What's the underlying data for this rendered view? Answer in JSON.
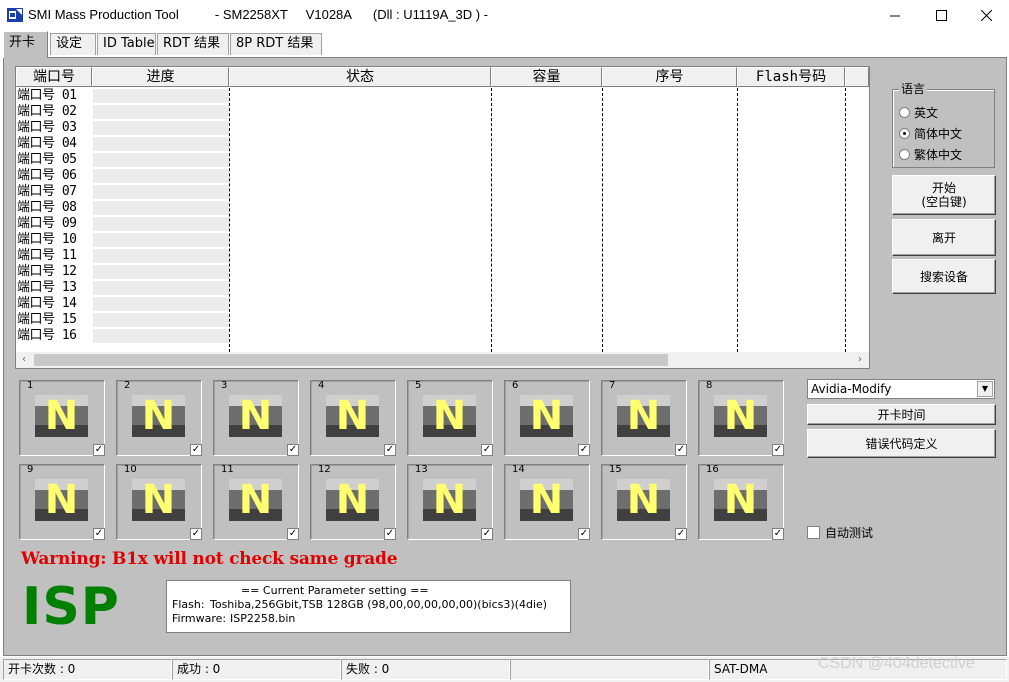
{
  "window": {
    "title": "SMI Mass Production Tool          - SM2258XT     V1028A      (Dll : U1119A_3D ) -",
    "icon": "usb-drive-icon"
  },
  "tabs": [
    {
      "label": "开卡",
      "active": true
    },
    {
      "label": "设定",
      "active": false
    },
    {
      "label": "ID Table",
      "active": false
    },
    {
      "label": "RDT 结果",
      "active": false
    },
    {
      "label": "8P RDT 结果",
      "active": false
    }
  ],
  "grid": {
    "columns": [
      "端口号",
      "进度",
      "状态",
      "容量",
      "序号",
      "Flash号码"
    ],
    "rows": [
      "端口号 01",
      "端口号 02",
      "端口号 03",
      "端口号 04",
      "端口号 05",
      "端口号 06",
      "端口号 07",
      "端口号 08",
      "端口号 09",
      "端口号 10",
      "端口号 11",
      "端口号 12",
      "端口号 13",
      "端口号 14",
      "端口号 15",
      "端口号 16"
    ]
  },
  "language": {
    "title": "语言",
    "options": [
      {
        "label": "英文",
        "selected": false
      },
      {
        "label": "简体中文",
        "selected": true
      },
      {
        "label": "繁体中文",
        "selected": false
      }
    ]
  },
  "buttons": {
    "start_line1": "开始",
    "start_line2": "(空白键)",
    "exit": "离开",
    "scan": "搜索设备",
    "open_card_time": "开卡时间",
    "error_code_def": "错误代码定义"
  },
  "ports": [
    {
      "num": "1",
      "status": "N",
      "checked": true
    },
    {
      "num": "2",
      "status": "N",
      "checked": true
    },
    {
      "num": "3",
      "status": "N",
      "checked": true
    },
    {
      "num": "4",
      "status": "N",
      "checked": true
    },
    {
      "num": "5",
      "status": "N",
      "checked": true
    },
    {
      "num": "6",
      "status": "N",
      "checked": true
    },
    {
      "num": "7",
      "status": "N",
      "checked": true
    },
    {
      "num": "8",
      "status": "N",
      "checked": true
    },
    {
      "num": "9",
      "status": "N",
      "checked": true
    },
    {
      "num": "10",
      "status": "N",
      "checked": true
    },
    {
      "num": "11",
      "status": "N",
      "checked": true
    },
    {
      "num": "12",
      "status": "N",
      "checked": true
    },
    {
      "num": "13",
      "status": "N",
      "checked": true
    },
    {
      "num": "14",
      "status": "N",
      "checked": true
    },
    {
      "num": "15",
      "status": "N",
      "checked": true
    },
    {
      "num": "16",
      "status": "N",
      "checked": true
    }
  ],
  "dropdown": {
    "value": "Avidia-Modify"
  },
  "auto_test": {
    "label": "自动测试",
    "checked": false
  },
  "warning": "Warning: B1x will not check same grade",
  "mode_label": "ISP",
  "params": {
    "header": "== Current Parameter setting ==",
    "flash_label": "Flash:",
    "flash_value": "Toshiba,256Gbit,TSB 128GB (98,00,00,00,00,00)(bics3)(4die)",
    "firmware_label": "Firmware:",
    "firmware_value": "ISP2258.bin"
  },
  "status": {
    "count": "开卡次数 : 0",
    "success": "成功 : 0",
    "fail": "失败 : 0",
    "empty": "",
    "interface": "SAT-DMA"
  },
  "watermark": "CSDN @404detective",
  "colors": {
    "warning": "#e00000",
    "isp": "#008000",
    "port_letter": "#ffff70",
    "panel": "#c0c0c0"
  }
}
